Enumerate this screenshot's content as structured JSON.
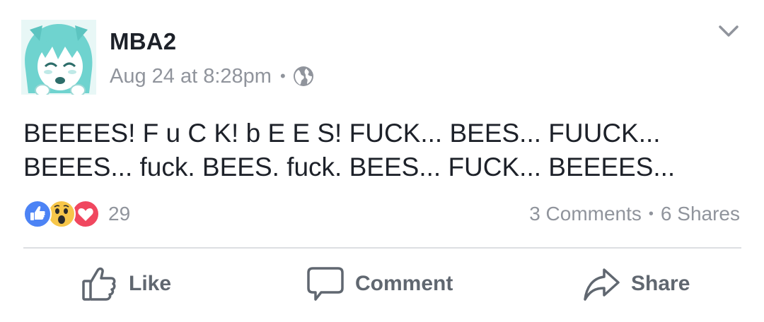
{
  "post": {
    "author": "MBA2",
    "timestamp": "Aug 24 at 8:28pm",
    "meta_separator": "•",
    "privacy_icon": "globe-icon",
    "menu_icon": "chevron-down-icon",
    "text": "BEEEES! F u C K! b E E S! FUCK... BEES... FUUCK...\nBEEES... fuck. BEES. fuck. BEES... FUCK... BEEEES...",
    "reactions": {
      "types": [
        "like",
        "wow",
        "love"
      ],
      "count": "29"
    },
    "stats": {
      "comments": "3 Comments",
      "separator": "•",
      "shares": "6 Shares"
    },
    "actions": {
      "like": "Like",
      "comment": "Comment",
      "share": "Share"
    }
  },
  "colors": {
    "like_blue": "#4c83f5",
    "wow_yellow": "#f7c64a",
    "love_red": "#f0475f",
    "text_primary": "#1d2129",
    "text_secondary": "#90949c",
    "action_grey": "#606770",
    "avatar_teal": "#6fd3cf"
  }
}
